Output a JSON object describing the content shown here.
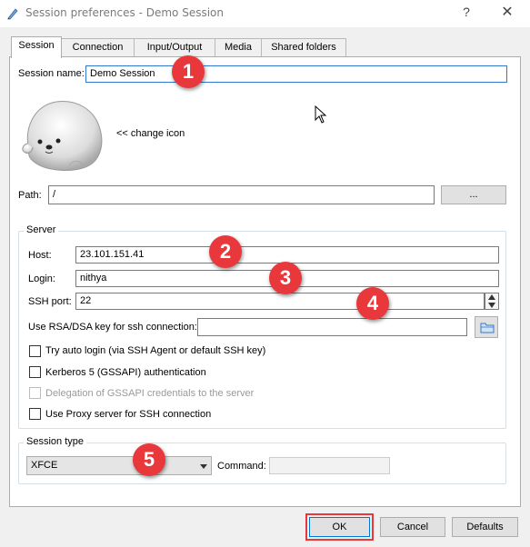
{
  "window": {
    "title": "Session preferences - Demo Session",
    "help_glyph": "?",
    "close_glyph": "✕"
  },
  "tabs": [
    {
      "label": "Session",
      "active": true
    },
    {
      "label": "Connection",
      "active": false
    },
    {
      "label": "Input/Output",
      "active": false
    },
    {
      "label": "Media",
      "active": false
    },
    {
      "label": "Shared folders",
      "active": false
    }
  ],
  "session": {
    "name_label": "Session name:",
    "name_value": "Demo Session",
    "change_icon_label": "<< change icon",
    "path_label": "Path:",
    "path_value": "/",
    "browse_label": "..."
  },
  "server": {
    "title": "Server",
    "host_label": "Host:",
    "host_value": "23.101.151.41",
    "login_label": "Login:",
    "login_value": "nithya",
    "ssh_port_label": "SSH port:",
    "ssh_port_value": "22",
    "rsa_label": "Use RSA/DSA key for ssh connection:",
    "rsa_value": "",
    "options": [
      {
        "label": "Try auto login (via SSH Agent or default SSH key)",
        "checked": false,
        "disabled": false
      },
      {
        "label": "Kerberos 5 (GSSAPI) authentication",
        "checked": false,
        "disabled": false
      },
      {
        "label": "Delegation of GSSAPI credentials to the server",
        "checked": false,
        "disabled": true
      },
      {
        "label": "Use Proxy server for SSH connection",
        "checked": false,
        "disabled": false
      }
    ]
  },
  "session_type": {
    "title": "Session type",
    "selected": "XFCE",
    "command_label": "Command:",
    "command_value": ""
  },
  "buttons": {
    "ok": "OK",
    "cancel": "Cancel",
    "defaults": "Defaults"
  },
  "markers": [
    "1",
    "2",
    "3",
    "4",
    "5"
  ],
  "colors": {
    "marker": "#e8383b",
    "ok_highlight": "#e8383b",
    "focus": "#3078d0"
  }
}
